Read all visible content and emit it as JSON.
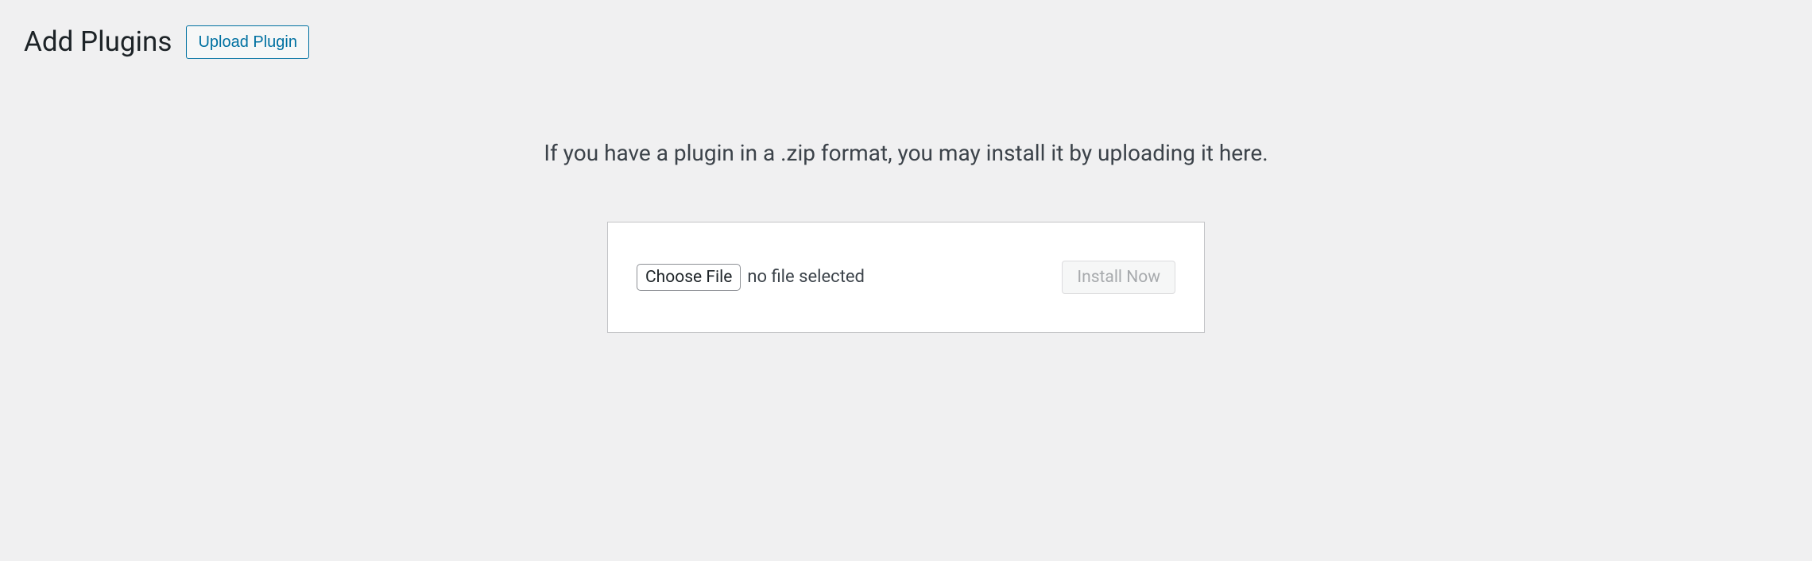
{
  "header": {
    "title": "Add Plugins",
    "upload_button_label": "Upload Plugin"
  },
  "upload": {
    "description": "If you have a plugin in a .zip format, you may install it by uploading it here.",
    "choose_file_label": "Choose File",
    "file_status": "no file selected",
    "install_button_label": "Install Now"
  }
}
